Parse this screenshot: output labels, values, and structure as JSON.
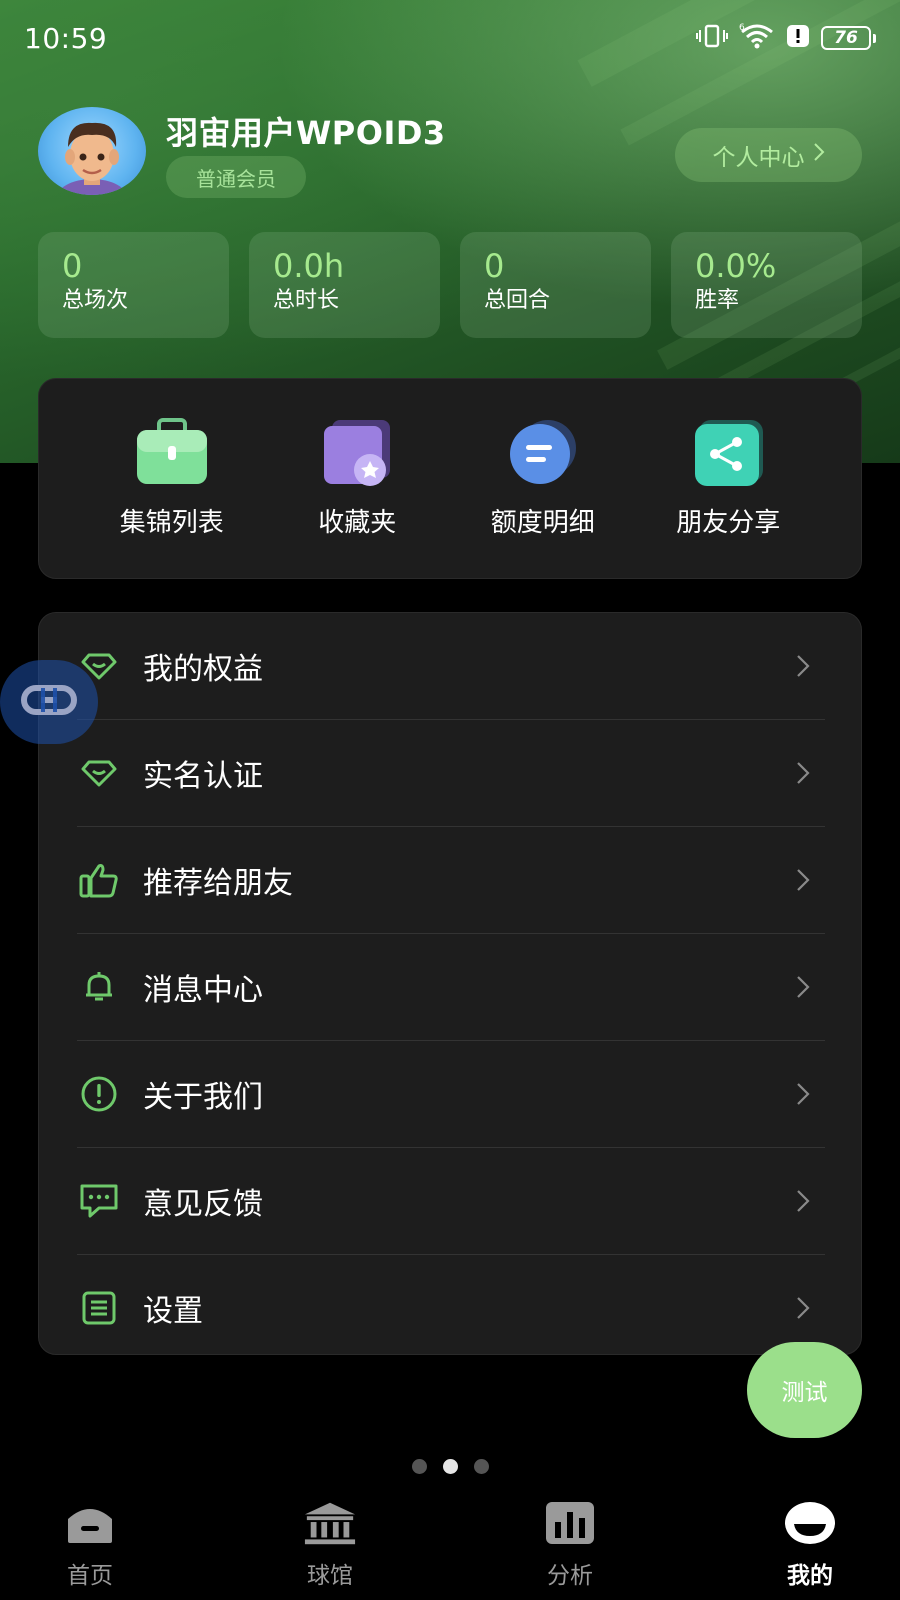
{
  "status_bar": {
    "time": "10:59",
    "battery": "76"
  },
  "profile": {
    "username": "羽宙用户WPOID3",
    "member_level": "普通会员",
    "personal_center_label": "个人中心"
  },
  "stats": [
    {
      "value": "0",
      "label": "总场次"
    },
    {
      "value": "0.0h",
      "label": "总时长"
    },
    {
      "value": "0",
      "label": "总回合"
    },
    {
      "value": "0.0%",
      "label": "胜率"
    }
  ],
  "quick_actions": [
    {
      "label": "集锦列表",
      "icon": "briefcase-icon"
    },
    {
      "label": "收藏夹",
      "icon": "favorites-folder-icon"
    },
    {
      "label": "额度明细",
      "icon": "quota-list-icon"
    },
    {
      "label": "朋友分享",
      "icon": "share-icon"
    }
  ],
  "menu": [
    {
      "label": "我的权益",
      "icon": "diamond-icon"
    },
    {
      "label": "实名认证",
      "icon": "diamond-icon"
    },
    {
      "label": "推荐给朋友",
      "icon": "thumbs-up-icon"
    },
    {
      "label": "消息中心",
      "icon": "bell-icon"
    },
    {
      "label": "关于我们",
      "icon": "info-circle-icon"
    },
    {
      "label": "意见反馈",
      "icon": "feedback-chat-icon"
    },
    {
      "label": "设置",
      "icon": "settings-list-icon"
    }
  ],
  "floating": {
    "test_button_label": "测试"
  },
  "pager": {
    "count": 3,
    "active_index": 1
  },
  "bottom_nav": [
    {
      "label": "首页",
      "icon": "home-icon",
      "active": false
    },
    {
      "label": "球馆",
      "icon": "stadium-icon",
      "active": false
    },
    {
      "label": "分析",
      "icon": "analysis-chart-icon",
      "active": false
    },
    {
      "label": "我的",
      "icon": "profile-icon",
      "active": true
    }
  ],
  "colors": {
    "accent_green": "#a6ea8e",
    "background": "#000000",
    "card": "#1d1d1d",
    "test_button": "#9bdf8b"
  }
}
